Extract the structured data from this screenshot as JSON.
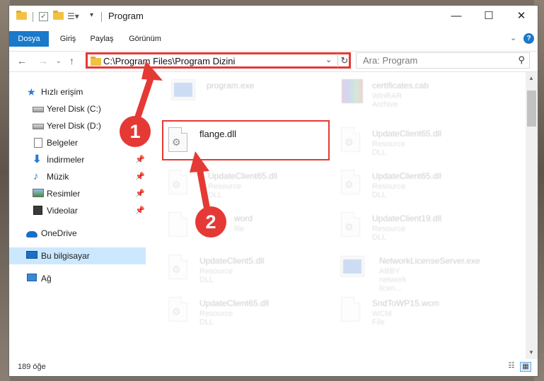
{
  "window": {
    "title": "Program"
  },
  "ribbon": {
    "tabs": [
      "Dosya",
      "Giriş",
      "Paylaş",
      "Görünüm"
    ],
    "expand_glyph": "⌄",
    "help_glyph": "?"
  },
  "address": {
    "path": "C:\\Program Files\\Program Dizini"
  },
  "search": {
    "placeholder": "Ara: Program"
  },
  "nav_pane": {
    "items": [
      {
        "label": "Hızlı erişim",
        "icon": "quick-access-star-icon"
      },
      {
        "label": "Yerel Disk (C:)",
        "icon": "drive-icon"
      },
      {
        "label": "Yerel Disk (D:)",
        "icon": "drive-icon"
      },
      {
        "label": "Belgeler",
        "icon": "documents-icon",
        "pinned": true
      },
      {
        "label": "İndirmeler",
        "icon": "downloads-icon",
        "pinned": true
      },
      {
        "label": "Müzik",
        "icon": "music-icon",
        "pinned": true
      },
      {
        "label": "Resimler",
        "icon": "pictures-icon",
        "pinned": true
      },
      {
        "label": "Videolar",
        "icon": "videos-icon",
        "pinned": true
      },
      {
        "label": "OneDrive",
        "icon": "onedrive-icon"
      },
      {
        "label": "Bu bilgisayar",
        "icon": "this-pc-icon",
        "selected": true
      },
      {
        "label": "Ağ",
        "icon": "network-icon"
      }
    ]
  },
  "files": [
    {
      "name": "program.exe",
      "type": ""
    },
    {
      "name": "certificates.cab",
      "type": "WinRAR Archive"
    },
    {
      "name": "flange.dll",
      "type": "",
      "highlighted": true
    },
    {
      "name": "UpdateClient65.dll",
      "type": "Resource DLL"
    },
    {
      "name": "UpdateClient65.dll",
      "type": "Resource DLL"
    },
    {
      "name": "UpdateClient65.dll",
      "type": "Resource DLL"
    },
    {
      "name": "word",
      "type": "file"
    },
    {
      "name": "UpdateClient19.dll",
      "type": "Resource DLL"
    },
    {
      "name": "UpdateClient5.dll",
      "type": "Resource DLL"
    },
    {
      "name": "NetworkLicenseServer.exe",
      "type": "ABBY network licen..."
    },
    {
      "name": "UpdateClient65.dll",
      "type": "Resource DLL"
    },
    {
      "name": "SndToWP15.wcm",
      "type": "WCM File"
    }
  ],
  "status": {
    "item_count": "189 öğe"
  },
  "callouts": [
    "1",
    "2"
  ],
  "colors": {
    "accent": "#1979ca",
    "annotation_red": "#e53935",
    "selected_bg": "#cce8ff"
  }
}
